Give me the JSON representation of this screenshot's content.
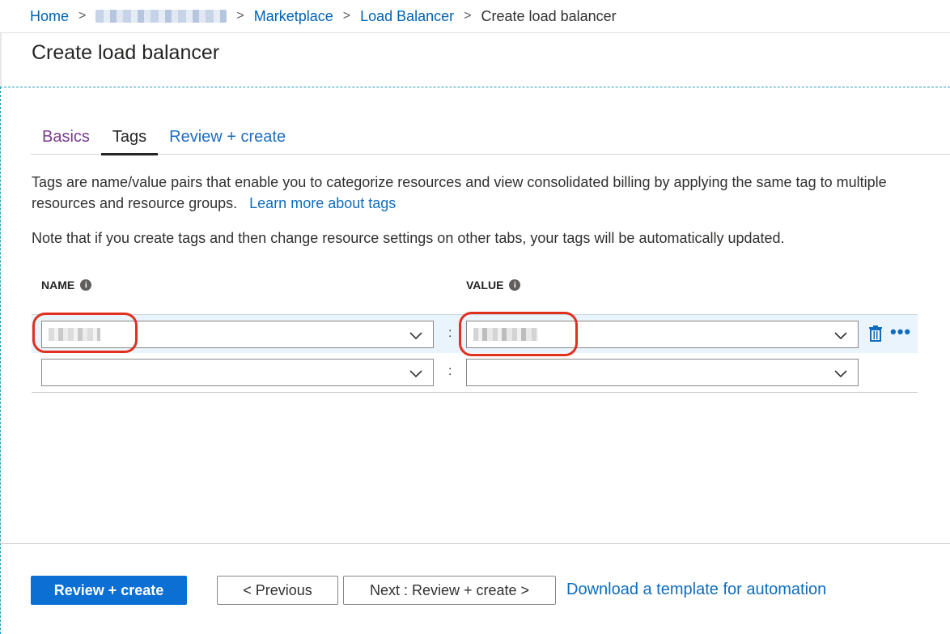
{
  "breadcrumb": {
    "home": "Home",
    "marketplace": "Marketplace",
    "load_balancer": "Load Balancer",
    "current": "Create load balancer",
    "separator": ">"
  },
  "page_title": "Create load balancer",
  "tabs": [
    {
      "label": "Basics"
    },
    {
      "label": "Tags",
      "selected": true
    },
    {
      "label": "Review + create"
    }
  ],
  "description": {
    "text": "Tags are name/value pairs that enable you to categorize resources and view consolidated billing by applying the same tag to multiple resources and resource groups.",
    "link": "Learn more about tags"
  },
  "note": "Note that if you create tags and then change resource settings on other tabs, your tags will be automatically updated.",
  "columns": {
    "name": "NAME",
    "value": "VALUE",
    "info_glyph": "i"
  },
  "tag_rows": [
    {
      "name": "",
      "value": "",
      "separator": ":"
    },
    {
      "name": "",
      "value": "",
      "separator": ":"
    }
  ],
  "row_actions": {
    "more": "•••",
    "delete_icon": "trash-icon"
  },
  "footer": {
    "review_create": "Review + create",
    "previous": "< Previous",
    "next": "Next : Review + create >",
    "download": "Download a template for automation"
  },
  "colors": {
    "accent": "#0b6fd4",
    "link": "#0f6cbd",
    "highlight_ring": "#e0301e",
    "basics_tab": "#7a3c8e"
  }
}
